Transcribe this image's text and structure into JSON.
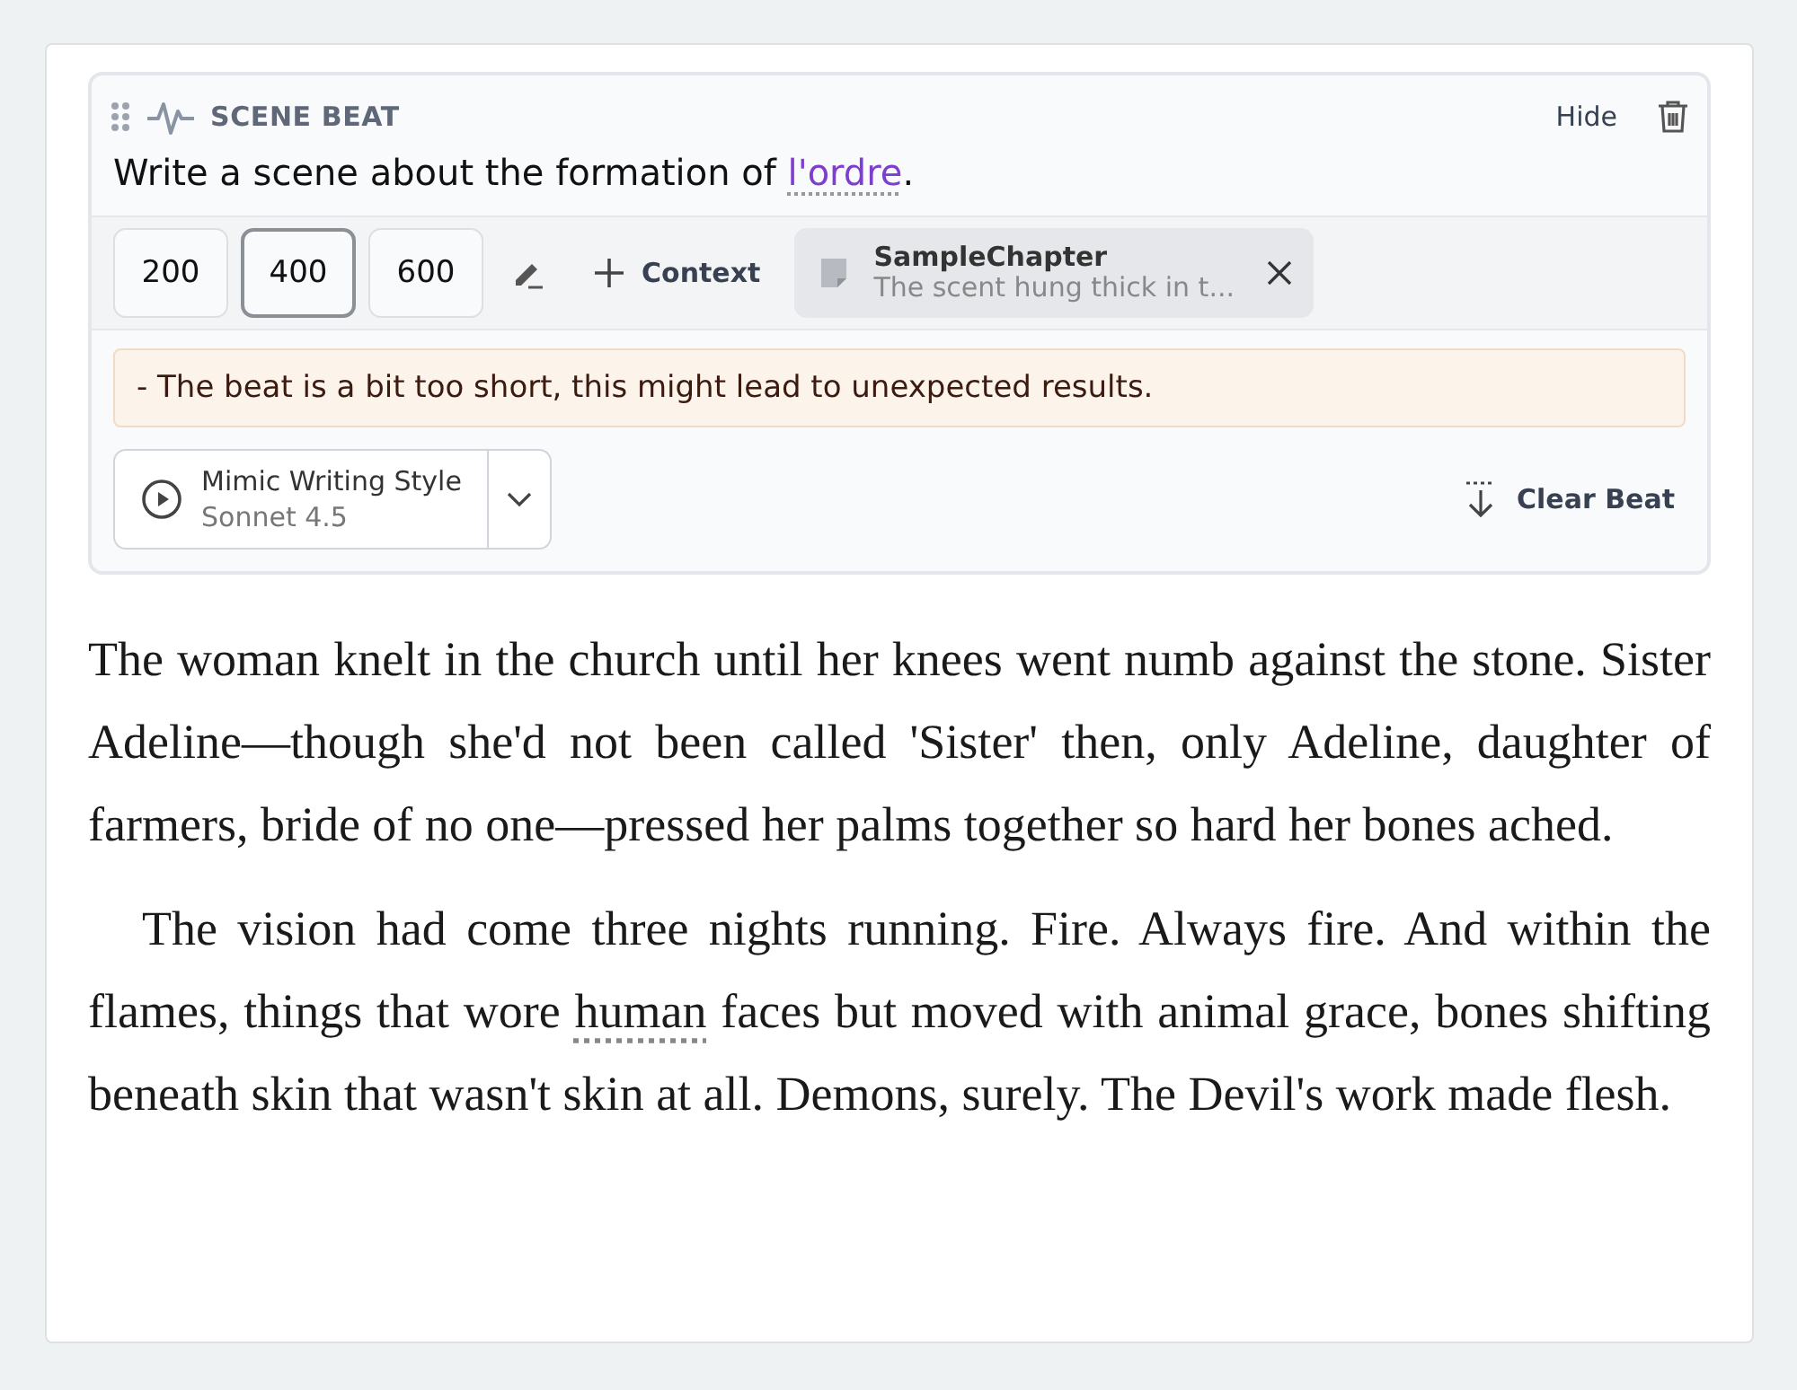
{
  "beat": {
    "label": "SCENE BEAT",
    "hide": "Hide",
    "prompt": {
      "before": "Write a scene about the formation of ",
      "link": "l'ordre",
      "after": "."
    },
    "lengths": [
      {
        "label": "200",
        "selected": false
      },
      {
        "label": "400",
        "selected": true
      },
      {
        "label": "600",
        "selected": false
      }
    ],
    "context_button": "Context",
    "context_chip": {
      "title": "SampleChapter",
      "excerpt": "The scent hung thick in t..."
    },
    "warning": "- The beat is a bit too short, this might lead to unexpected results.",
    "generate": {
      "label": "Mimic Writing Style",
      "model": "Sonnet 4.5"
    },
    "clear": "Clear Beat"
  },
  "paragraphs": [
    {
      "indent": false,
      "before": "The woman knelt in the church until her knees went numb against the stone. Sister Adeline—though she'd not been called 'Sister' then, only Adeline, daughter of farmers, bride of no one—pressed her palms together so hard her bones ached."
    },
    {
      "indent": true,
      "before": "The vision had come three nights running. Fire. Always fire. And within the flames, things that wore ",
      "link": "human",
      "after": " faces but moved with animal grace, bones shifting beneath skin that wasn't skin at all. Demons, surely. The Devil's work made flesh."
    }
  ]
}
